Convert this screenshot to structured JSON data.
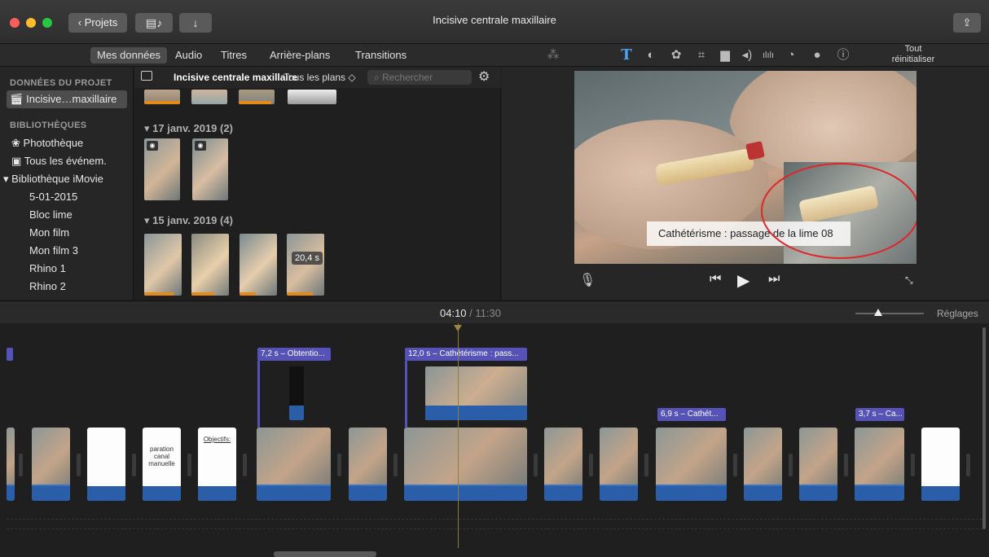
{
  "window": {
    "title": "Incisive centrale maxillaire",
    "projects_button": "Projets",
    "media_icon": "film-music-icon",
    "import_icon": "download-arrow-icon",
    "share_icon": "share-icon"
  },
  "toolbar": {
    "tabs": [
      "Mes données",
      "Audio",
      "Titres",
      "Arrière-plans",
      "Transitions"
    ],
    "active_tab": "Mes données",
    "tools": [
      "magic-wand-icon",
      "text-icon",
      "color-balance-icon",
      "palette-icon",
      "crop-icon",
      "stabilization-icon",
      "volume-icon",
      "equalizer-icon",
      "speed-icon",
      "filter-icon",
      "info-icon"
    ],
    "reset_label_1": "Tout",
    "reset_label_2": "réinitialiser"
  },
  "sidebar": {
    "project_header": "DONNÉES DU PROJET",
    "project_item": "Incisive…maxillaire",
    "libraries_header": "BIBLIOTHÈQUES",
    "items": [
      "Photothèque",
      "Tous les événem.",
      "Bibliothèque iMovie",
      "5-01-2015",
      "Bloc lime",
      "Mon film",
      "Mon film 3",
      "Rhino 1",
      "Rhino 2"
    ]
  },
  "browser": {
    "title": "Incisive centrale maxillaire",
    "filter": "Tous les plans ◇",
    "search_placeholder": "Rechercher",
    "groups": [
      {
        "date": "▾  17 janv. 2019  (2)"
      },
      {
        "date": "▾  15 janv. 2019  (4)"
      }
    ],
    "duration_badge": "20,4 s"
  },
  "viewer": {
    "caption": "Cathétérisme : passage de la lime 08",
    "highlight_color": "#e0262a"
  },
  "timeline": {
    "current_time": "04:10",
    "separator": " / ",
    "total_time": "11:30",
    "settings_label": "Réglages",
    "title_labels": [
      "7,2 s – Obtentio...",
      "12,0 s – Cathétérisme : pass...",
      "6,9 s – Cathét...",
      "3,7 s – Ca..."
    ],
    "slides": [
      "paration canal manuelle",
      "Objectifs:"
    ]
  },
  "colors": {
    "accent_blue": "#4aa3f5",
    "title_purple": "#5552b8",
    "clip_band": "#2a5ea8"
  }
}
